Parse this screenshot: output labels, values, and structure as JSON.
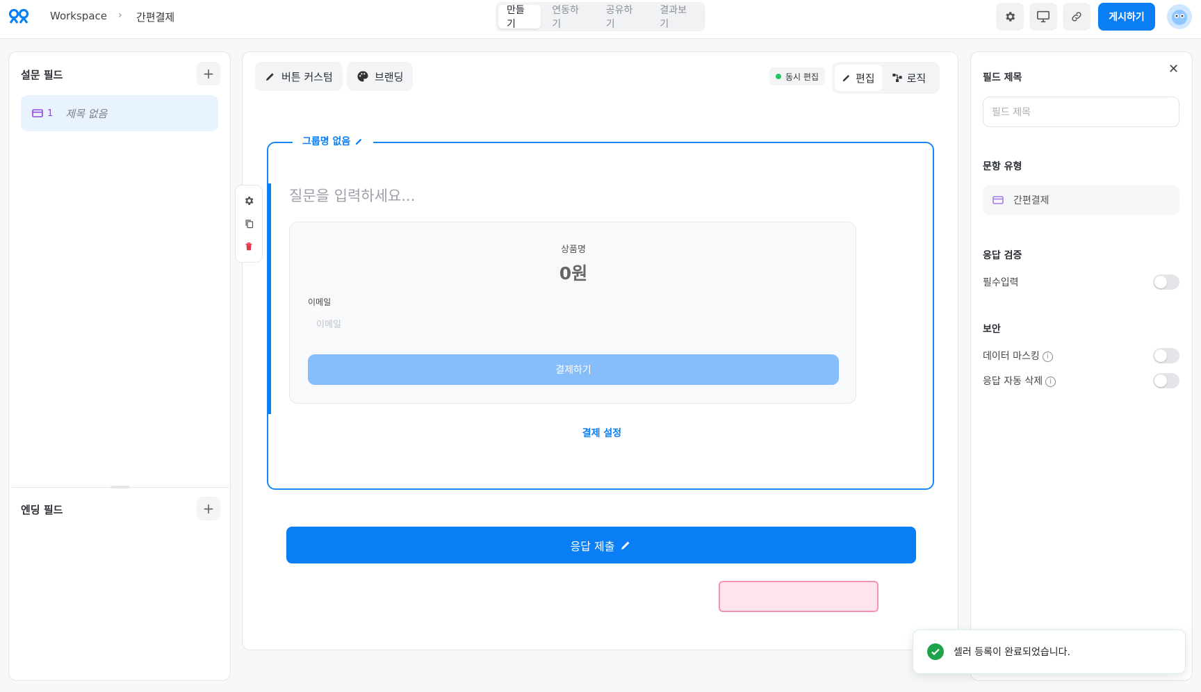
{
  "header": {
    "breadcrumb_workspace": "Workspace",
    "breadcrumb_sep": "›",
    "breadcrumb_current": "간편결제",
    "tabs": [
      {
        "label": "만들기",
        "active": true
      },
      {
        "label": "연동하기",
        "active": false
      },
      {
        "label": "공유하기",
        "active": false
      },
      {
        "label": "결과보기",
        "active": false
      }
    ],
    "icons": [
      "gear-icon",
      "monitor-icon",
      "link-icon"
    ],
    "publish_label": "게시하기",
    "accent": "#0a7ff5"
  },
  "left_panel": {
    "survey_fields_title": "설문 필드",
    "fields": [
      {
        "number": "1",
        "title": "제목 없음",
        "icon": "card-icon"
      }
    ],
    "ending_fields_title": "엔딩 필드"
  },
  "toolbar": {
    "button_custom_label": "버튼 커스텀",
    "branding_label": "브랜딩",
    "live_edit_label": "동시 편집",
    "edit_label": "편집",
    "logic_label": "로직"
  },
  "group": {
    "name": "그룹명 없음",
    "question_placeholder": "질문을 입력하세요...",
    "payment": {
      "product_name": "상품명",
      "price": "0원",
      "email_label": "이메일",
      "email_placeholder": "이메일",
      "pay_button": "결제하기"
    },
    "payment_settings_link": "결제 설정"
  },
  "submit_label": "응답 제출",
  "right_panel": {
    "field_title_label": "필드 제목",
    "field_title_placeholder": "필드 제목",
    "question_type_label": "문항 유형",
    "question_type_value": "간편결제",
    "validation_label": "응답 검증",
    "required_label": "필수입력",
    "required_on": false,
    "security_label": "보안",
    "data_masking_label": "데이터 마스킹",
    "data_masking_on": false,
    "auto_delete_label": "응답 자동 삭제",
    "auto_delete_on": false
  },
  "toast": {
    "message": "셀러 등록이 완료되었습니다."
  }
}
